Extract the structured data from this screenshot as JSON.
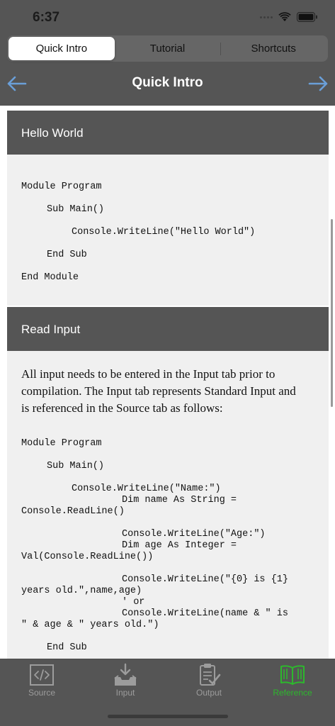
{
  "status": {
    "time": "6:37"
  },
  "segments": [
    {
      "label": "Quick Intro",
      "selected": true
    },
    {
      "label": "Tutorial",
      "selected": false
    },
    {
      "label": "Shortcuts",
      "selected": false
    }
  ],
  "nav": {
    "title": "Quick Intro",
    "left_icon": "arrow-left-icon",
    "right_icon": "arrow-right-icon"
  },
  "sections": [
    {
      "header": "Hello World",
      "code": [
        "Module Program",
        "Sub Main()",
        "Console.WriteLine(\"Hello World\")",
        "End Sub",
        "End Module"
      ]
    },
    {
      "header": "Read Input",
      "text": "All input needs to be entered in the Input tab prior to compilation. The Input tab represents Standard Input and is referenced in the Source tab as follows:",
      "code": [
        "Module Program",
        "Sub Main()",
        "Console.WriteLine(\"Name:\")",
        "Dim name As String =",
        "Console.ReadLine()",
        "Console.WriteLine(\"Age:\")",
        "Dim age As Integer =",
        "Val(Console.ReadLine())",
        "Console.WriteLine(\"{0} is {1}",
        "years old.\",name,age)",
        "' or",
        "Console.WriteLine(name & \" is",
        "\" & age & \" years old.\")",
        "End Sub"
      ]
    }
  ],
  "tabs": [
    {
      "label": "Source",
      "icon": "code-icon",
      "active": false
    },
    {
      "label": "Input",
      "icon": "input-tray-icon",
      "active": false
    },
    {
      "label": "Output",
      "icon": "clipboard-check-icon",
      "active": false
    },
    {
      "label": "Reference",
      "icon": "book-icon",
      "active": true
    }
  ],
  "colors": {
    "accent": "#2db82d",
    "arrow": "#6a9fd8",
    "header_bg": "#555555",
    "body_bg": "#f0f0f0"
  }
}
